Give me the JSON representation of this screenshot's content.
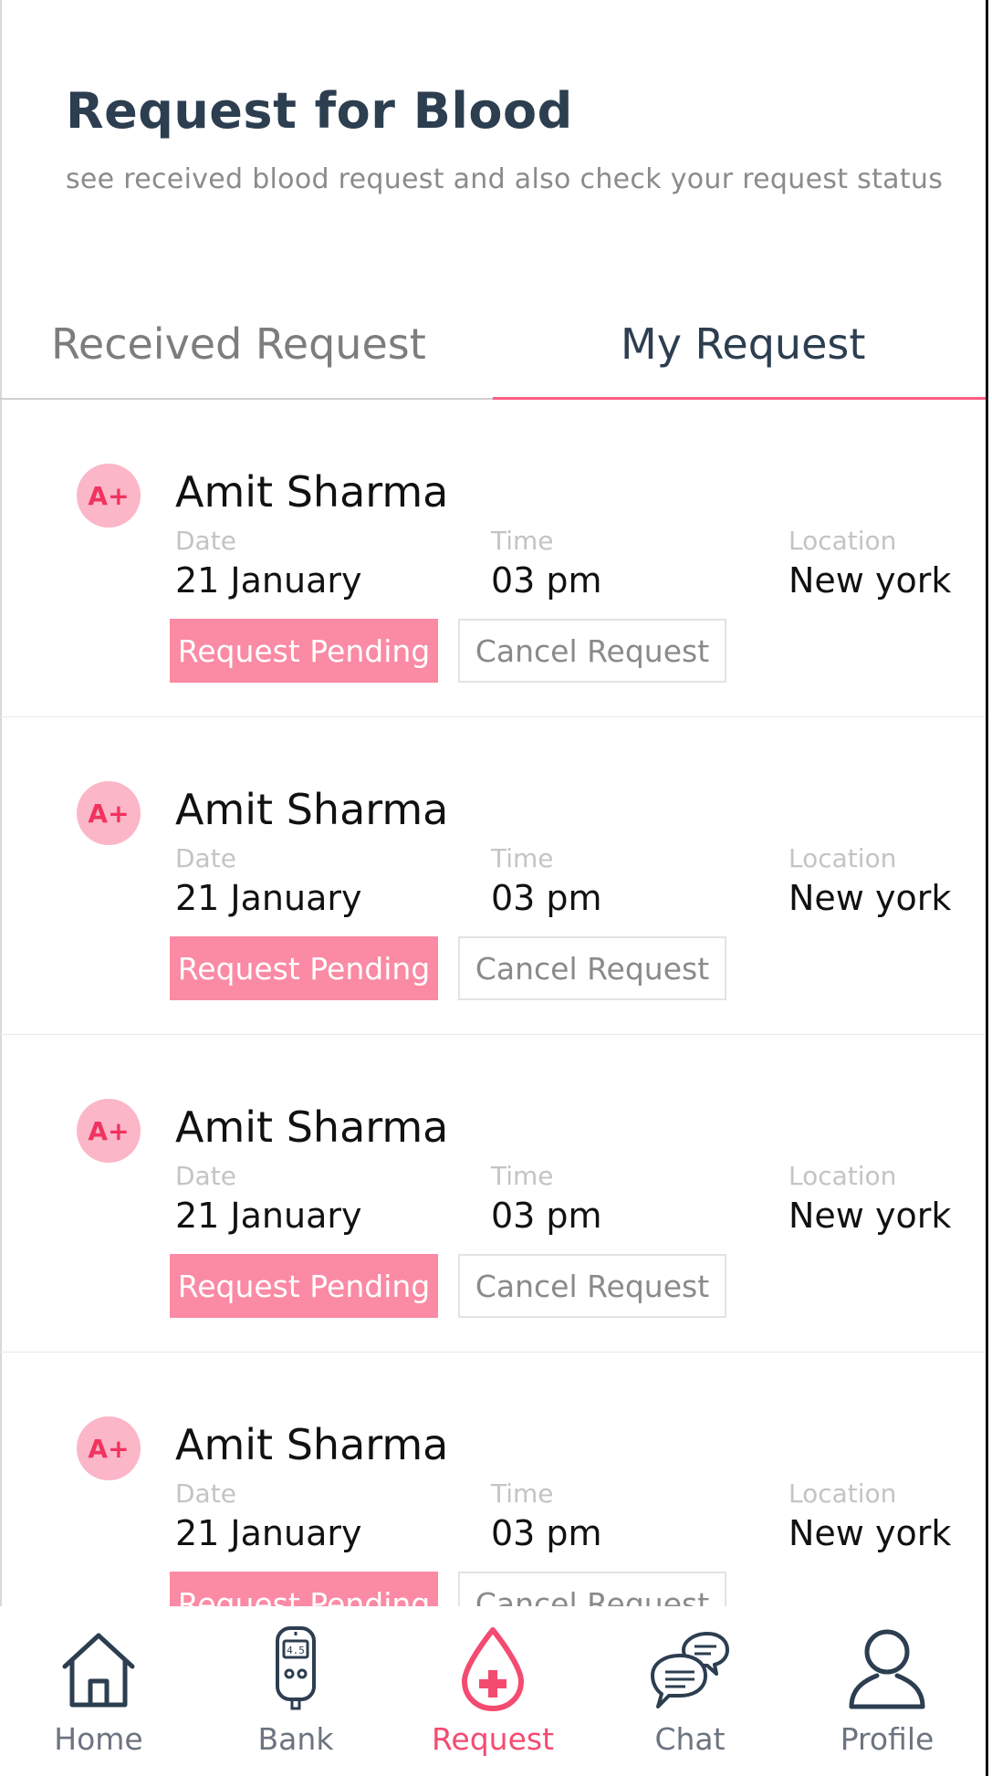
{
  "header": {
    "title": "Request for Blood",
    "subtitle": "see received blood request and also check your request status"
  },
  "tabs": [
    {
      "label": "Received Request",
      "active": false
    },
    {
      "label": "My Request",
      "active": true
    }
  ],
  "labels": {
    "date": "Date",
    "time": "Time",
    "location": "Location"
  },
  "requests": [
    {
      "blood_group": "A+",
      "name": "Amit Sharma",
      "date": "21 January",
      "time": "03 pm",
      "location": "New york",
      "status": "Request Pending",
      "cancel_label": "Cancel Request"
    },
    {
      "blood_group": "A+",
      "name": "Amit Sharma",
      "date": "21 January",
      "time": "03 pm",
      "location": "New york",
      "status": "Request Pending",
      "cancel_label": "Cancel Request"
    },
    {
      "blood_group": "A+",
      "name": "Amit Sharma",
      "date": "21 January",
      "time": "03 pm",
      "location": "New york",
      "status": "Request Pending",
      "cancel_label": "Cancel Request"
    },
    {
      "blood_group": "A+",
      "name": "Amit Sharma",
      "date": "21 January",
      "time": "03 pm",
      "location": "New york",
      "status": "Request Pending",
      "cancel_label": "Cancel Request"
    }
  ],
  "bottom_nav": [
    {
      "label": "Home",
      "icon": "home-icon",
      "active": false
    },
    {
      "label": "Bank",
      "icon": "glucometer-icon",
      "active": false
    },
    {
      "label": "Request",
      "icon": "blood-drop-icon",
      "active": true
    },
    {
      "label": "Chat",
      "icon": "chat-icon",
      "active": false
    },
    {
      "label": "Profile",
      "icon": "profile-icon",
      "active": false
    }
  ],
  "colors": {
    "accent": "#fb5c84",
    "pending_bg": "#fb8aa4",
    "avatar_bg": "#fbb6c7",
    "title": "#2c3e50",
    "nav_active": "#f44b70"
  }
}
